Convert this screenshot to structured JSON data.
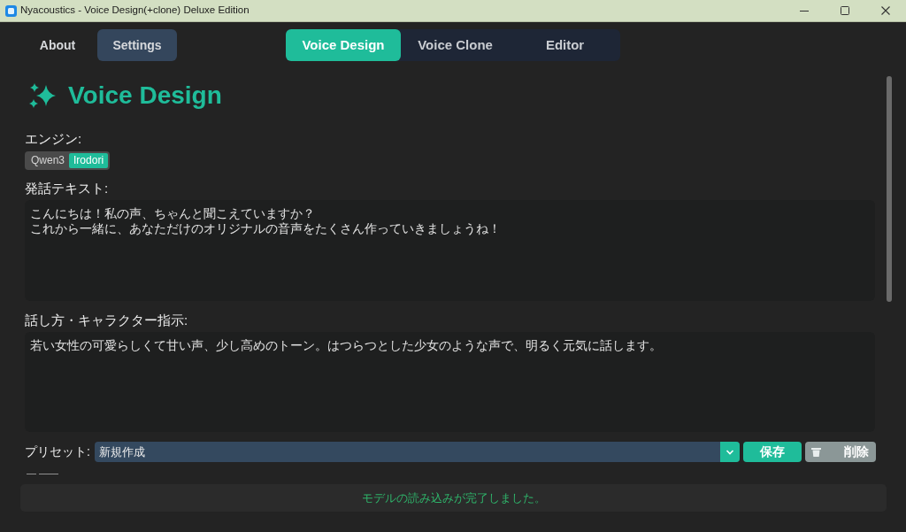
{
  "window": {
    "title": "Nyacoustics - Voice Design(+clone) Deluxe Edition"
  },
  "nav_buttons": [
    {
      "label": "About",
      "kind": "text"
    },
    {
      "label": "Settings",
      "kind": "filled"
    }
  ],
  "tabs": [
    {
      "label": "Voice Design",
      "selected": true
    },
    {
      "label": "Voice Clone",
      "selected": false
    },
    {
      "label": "Editor",
      "selected": false
    }
  ],
  "page": {
    "title": "Voice Design"
  },
  "engine": {
    "label": "エンジン:",
    "options": [
      {
        "label": "Qwen3",
        "selected": false
      },
      {
        "label": "Irodori",
        "selected": true
      }
    ]
  },
  "speech_text": {
    "label": "発話テキスト:",
    "lines": [
      "こんにちは！私の声、ちゃんと聞こえていますか？",
      "これから一緒に、あなただけのオリジナルの音声をたくさん作っていきましょうね！"
    ]
  },
  "style_prompt": {
    "label": "話し方・キャラクター指示:",
    "value": "若い女性の可愛らしくて甘い声、少し高めのトーン。はつらつとした少女のような声で、明るく元気に話します。"
  },
  "preset": {
    "label": "プリセット:",
    "value": "新規作成",
    "buttons": [
      {
        "label": "保存",
        "kind": "save"
      },
      {
        "label": "削除",
        "kind": "delete"
      }
    ]
  },
  "info_text": "— ——",
  "status_bar": {
    "text": "モデルの読み込みが完了しました。"
  }
}
